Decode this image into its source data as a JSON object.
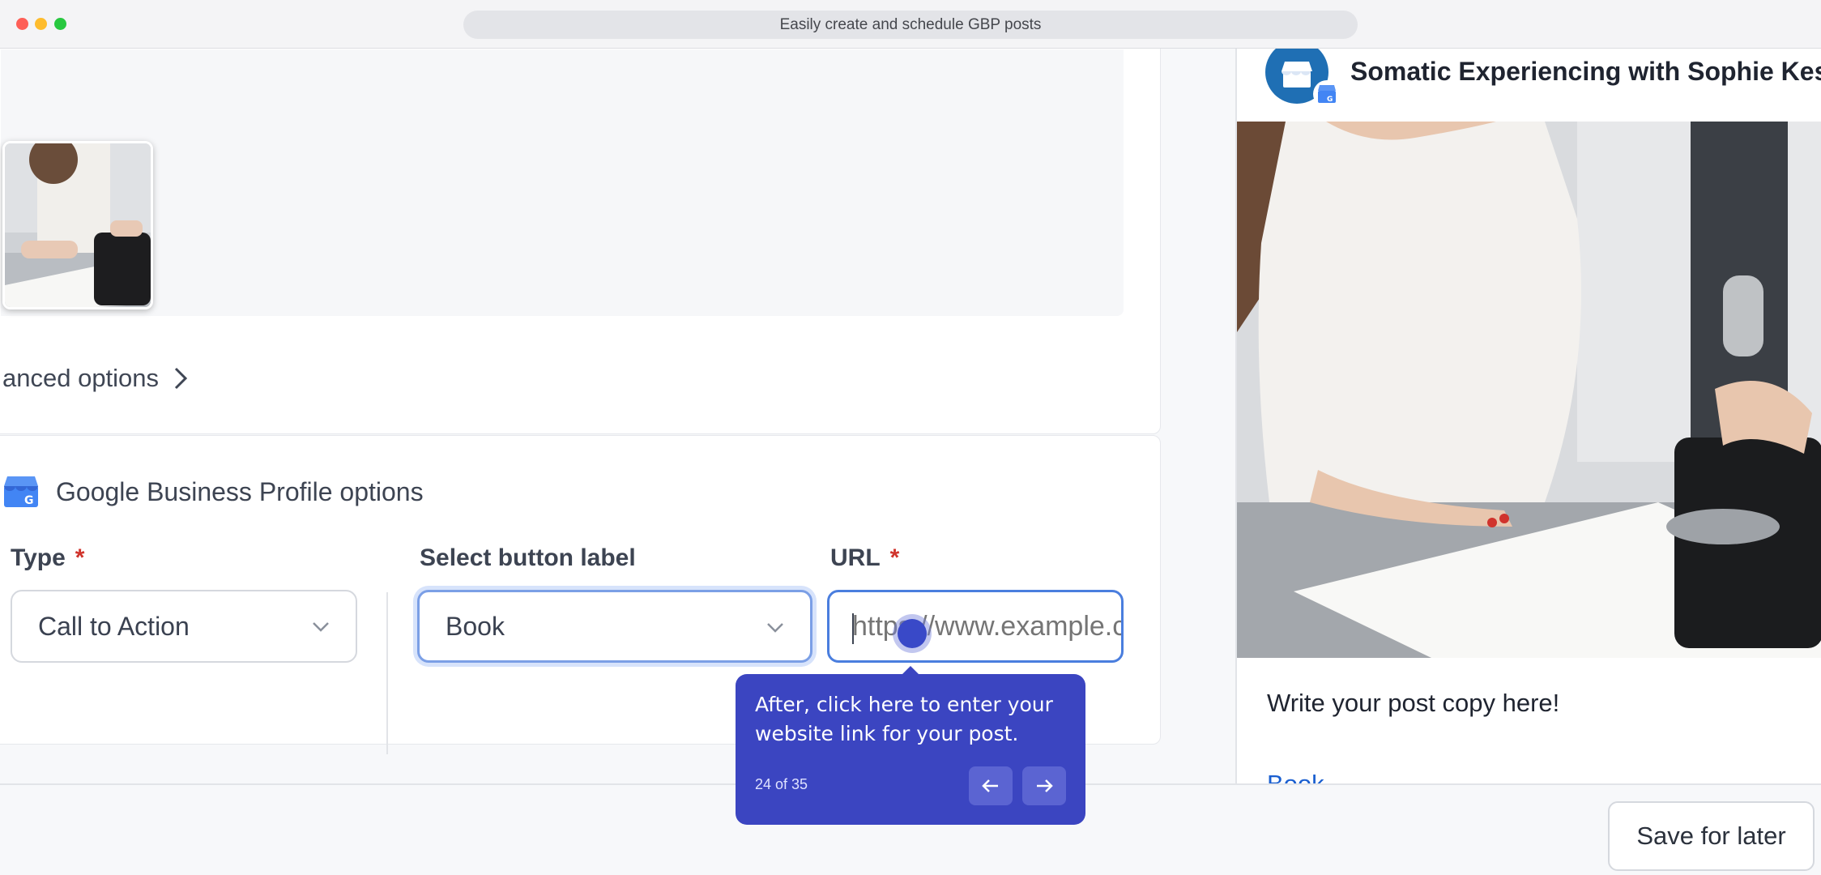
{
  "window": {
    "title": "Easily create and schedule GBP posts"
  },
  "editor": {
    "advanced_options_label": "anced options",
    "gbp_section_title": "Google Business Profile options",
    "type_label": "Type",
    "type_required": "*",
    "type_value": "Call to Action",
    "button_label_label": "Select button label",
    "button_label_value": "Book",
    "url_label": "URL",
    "url_required": "*",
    "url_placeholder": "https://www.example.com"
  },
  "preview": {
    "business_name": "Somatic Experiencing with Sophie Kessner",
    "post_copy": "Write your post copy here!",
    "cta_label": "Book"
  },
  "tour": {
    "text": "After, click here to enter your website link for your post.",
    "step": "24 of 35"
  },
  "footer": {
    "save_label": "Save for later"
  },
  "colors": {
    "accent": "#3b45c1",
    "focus_border": "#4a7ede",
    "required": "#d0342c",
    "link": "#1a5fd0"
  }
}
